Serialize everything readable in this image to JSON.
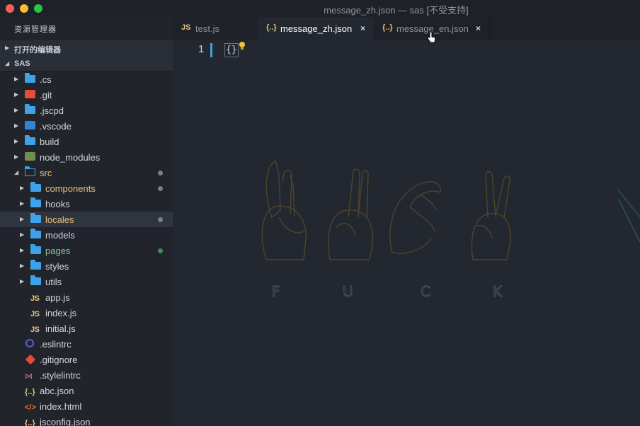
{
  "window": {
    "title": "message_zh.json — sas [不受支持]"
  },
  "sidebar": {
    "title": "资源管理器",
    "open_editors_label": "打开的编辑器",
    "project_label": "SAS",
    "items": [
      {
        "name": ".cs",
        "kind": "folder",
        "depth": 0,
        "icon": "folder-icon"
      },
      {
        "name": ".git",
        "kind": "folder",
        "depth": 0,
        "icon": "git-folder-icon"
      },
      {
        "name": ".jscpd",
        "kind": "folder",
        "depth": 0,
        "icon": "folder-icon"
      },
      {
        "name": ".vscode",
        "kind": "folder",
        "depth": 0,
        "icon": "vscode-folder-icon"
      },
      {
        "name": "build",
        "kind": "folder",
        "depth": 0,
        "icon": "folder-icon"
      },
      {
        "name": "node_modules",
        "kind": "folder",
        "depth": 0,
        "icon": "node-folder-icon"
      },
      {
        "name": "src",
        "kind": "folder-open",
        "depth": 0,
        "icon": "folder-open-icon",
        "color": "#e5c07b",
        "badge": "dot"
      },
      {
        "name": "components",
        "kind": "folder",
        "depth": 1,
        "icon": "folder-icon",
        "color": "#e5c07b",
        "badge": "dot"
      },
      {
        "name": "hooks",
        "kind": "folder",
        "depth": 1,
        "icon": "folder-icon"
      },
      {
        "name": "locales",
        "kind": "folder",
        "depth": 1,
        "icon": "folder-icon",
        "color": "#e5c07b",
        "badge": "dot",
        "selected": true
      },
      {
        "name": "models",
        "kind": "folder",
        "depth": 1,
        "icon": "folder-icon"
      },
      {
        "name": "pages",
        "kind": "folder",
        "depth": 1,
        "icon": "folder-icon",
        "color": "#7ec699",
        "badge": "dot-green"
      },
      {
        "name": "styles",
        "kind": "folder",
        "depth": 1,
        "icon": "folder-icon"
      },
      {
        "name": "utils",
        "kind": "folder",
        "depth": 1,
        "icon": "folder-icon"
      },
      {
        "name": "app.js",
        "kind": "file",
        "depth": 1,
        "icon": "js-file-icon"
      },
      {
        "name": "index.js",
        "kind": "file",
        "depth": 1,
        "icon": "js-file-icon"
      },
      {
        "name": "initial.js",
        "kind": "file",
        "depth": 1,
        "icon": "js-file-icon"
      },
      {
        "name": ".eslintrc",
        "kind": "file",
        "depth": 0,
        "icon": "eslint-icon"
      },
      {
        "name": ".gitignore",
        "kind": "file",
        "depth": 0,
        "icon": "git-file-icon"
      },
      {
        "name": ".stylelintrc",
        "kind": "file",
        "depth": 0,
        "icon": "stylelint-icon"
      },
      {
        "name": "abc.json",
        "kind": "file",
        "depth": 0,
        "icon": "json-file-icon"
      },
      {
        "name": "index.html",
        "kind": "file",
        "depth": 0,
        "icon": "html-file-icon"
      },
      {
        "name": "jsconfig.json",
        "kind": "file",
        "depth": 0,
        "icon": "json-file-icon"
      }
    ]
  },
  "tabs": [
    {
      "label": "test.js",
      "icon_text": "JS",
      "active": false
    },
    {
      "label": "message_zh.json",
      "icon_text": "{..}",
      "active": true,
      "close": "×"
    },
    {
      "label": "message_en.json",
      "icon_text": "{..}",
      "active": false,
      "close": "×"
    }
  ],
  "editor": {
    "line_number": "1",
    "code": "{}"
  },
  "watermark": {
    "letters": [
      "F",
      "U",
      "C",
      "K"
    ]
  },
  "colors": {
    "accent": "#3fa2e8",
    "modified": "#e5c07b",
    "untracked": "#7ec699"
  }
}
